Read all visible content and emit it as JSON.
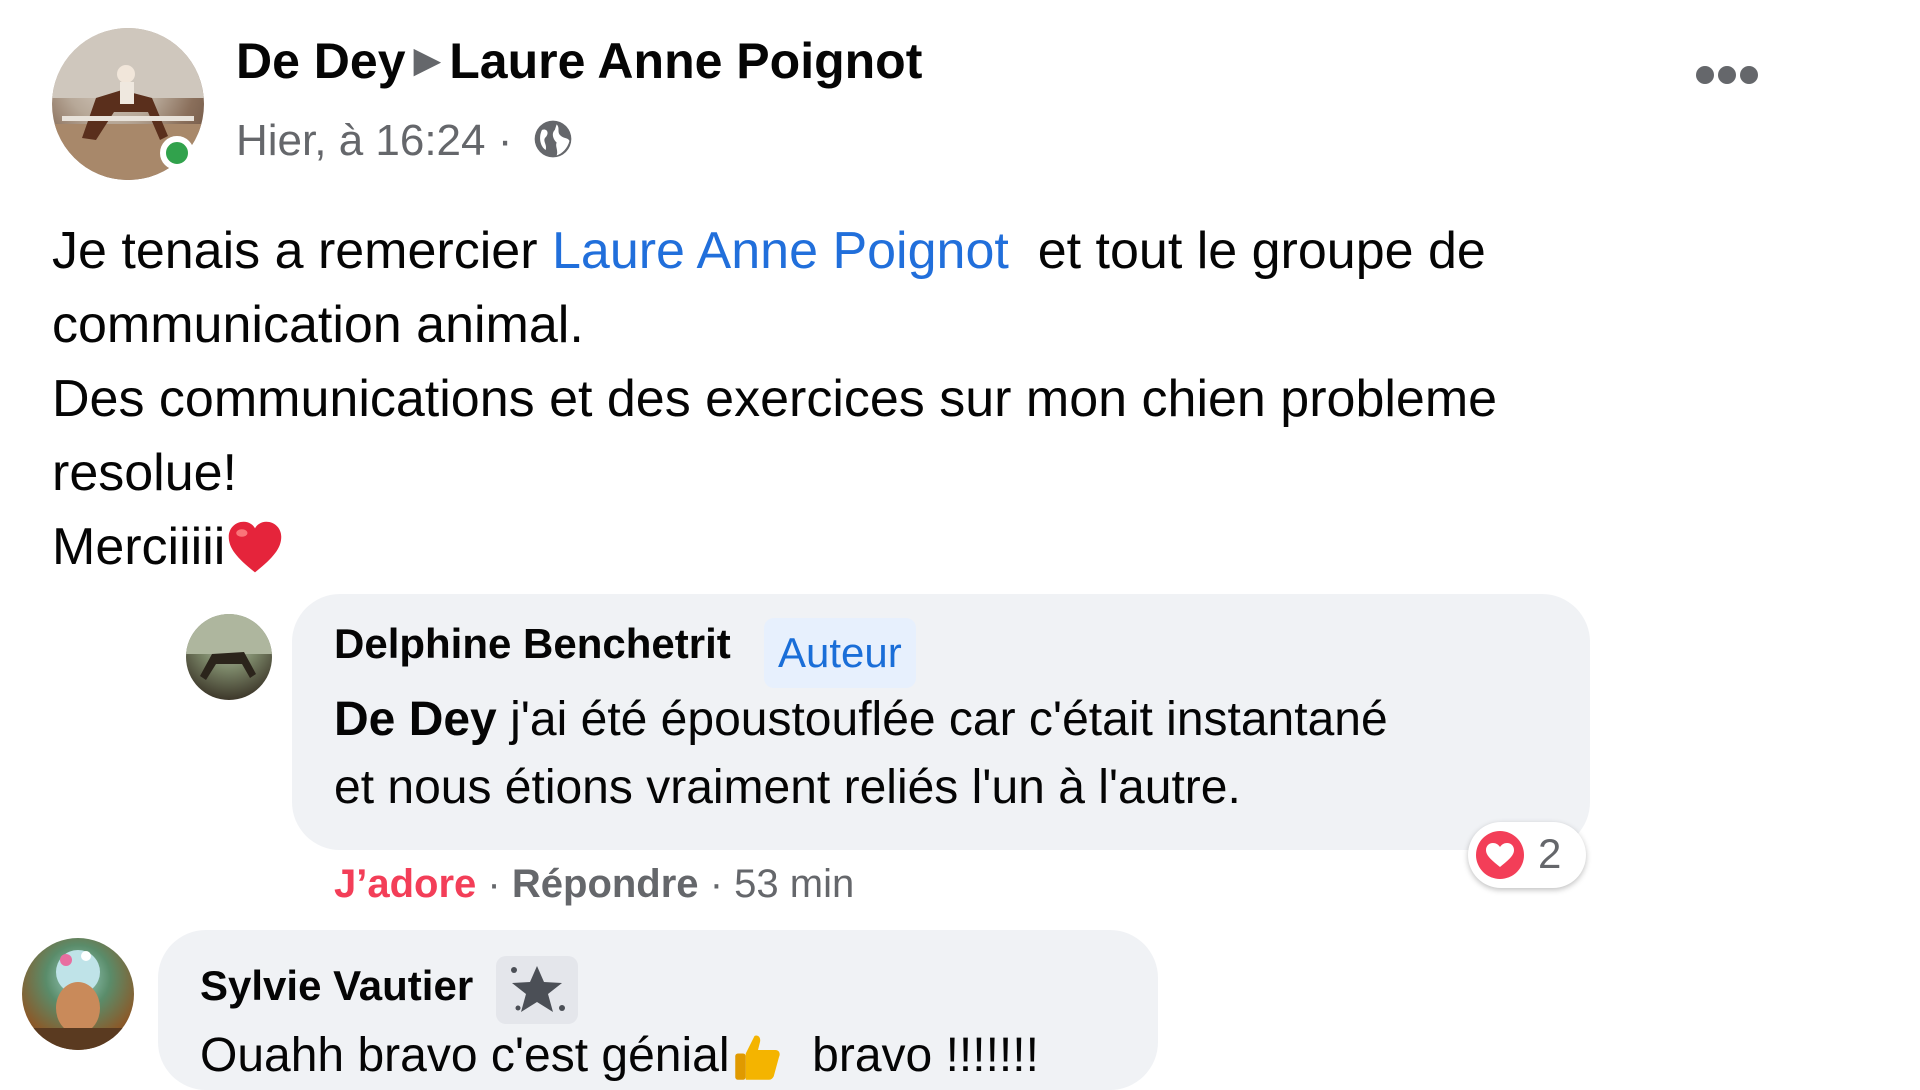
{
  "post": {
    "author": "De Dey",
    "target": "Laure Anne Poignot",
    "timestamp": "Hier, à 16:24",
    "separator": "·",
    "privacy_icon": "globe-icon",
    "menu_icon": "more-icon",
    "online": true,
    "body": {
      "line1_prefix": "Je tenais a remercier",
      "line1_mention": "Laure Anne Poignot",
      "line1_suffix": "et tout le groupe de",
      "line2": "communication animal.",
      "line3": "Des communications et des exercices sur mon chien probleme",
      "line4": "resolue!",
      "line5": "Merciiiii",
      "line5_emoji": "red-heart"
    }
  },
  "comments": [
    {
      "name": "Delphine Benchetrit",
      "badge": "Auteur",
      "tag": "De Dey",
      "text_line1": "j'ai été époustouflée car c'était instantané",
      "text_line2": "et nous étions vraiment reliés l'un à l'autre.",
      "reaction_icon": "love-reaction-icon",
      "reaction_count": "2",
      "actions": {
        "love": "J’adore",
        "sep1": "·",
        "reply": "Répondre",
        "sep2": "·",
        "time": "53 min"
      }
    },
    {
      "name": "Sylvie Vautier",
      "badge_icon": "top-fan-icon",
      "text_prefix": "Ouahh bravo c'est génial",
      "text_emoji": "thumbs-up",
      "text_suffix": "bravo !!!!!!!"
    }
  ],
  "colors": {
    "link": "#216fdb",
    "love": "#f33e58",
    "bubble": "#f0f2f5",
    "secondary_text": "#65676b",
    "online": "#31a24c",
    "author_badge_bg": "#e7f0fd"
  }
}
